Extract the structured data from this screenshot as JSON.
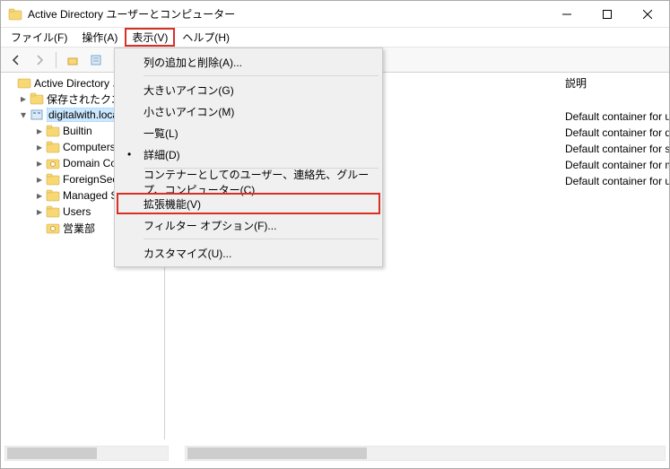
{
  "window": {
    "title": "Active Directory ユーザーとコンピューター"
  },
  "menubar": {
    "file": "ファイル(F)",
    "action": "操作(A)",
    "view": "表示(V)",
    "help": "ヘルプ(H)"
  },
  "view_menu": {
    "add_remove_columns": "列の追加と削除(A)...",
    "large_icons": "大きいアイコン(G)",
    "small_icons": "小さいアイコン(M)",
    "list": "一覧(L)",
    "detail": "詳細(D)",
    "containers": "コンテナーとしてのユーザー、連絡先、グループ、コンピューター(C)",
    "advanced": "拡張機能(V)",
    "filter_options": "フィルター オプション(F)...",
    "customize": "カスタマイズ(U)..."
  },
  "tree": {
    "root": "Active Directory ユ",
    "saved_queries": "保存されたクエリ",
    "domain": "digitalwith.loca",
    "children": {
      "builtin": "Builtin",
      "computers": "Computers",
      "domain_controllers": "Domain Co",
      "fsp": "ForeignSecu",
      "msa": "Managed S",
      "users": "Users",
      "sales": "営業部"
    }
  },
  "list_header": {
    "description": "説明"
  },
  "descriptions": {
    "r1": "Default container for up",
    "r2": "Default container for do",
    "r3": "Default container for se",
    "r4": "Default container for m",
    "r5": "Default container for up"
  }
}
